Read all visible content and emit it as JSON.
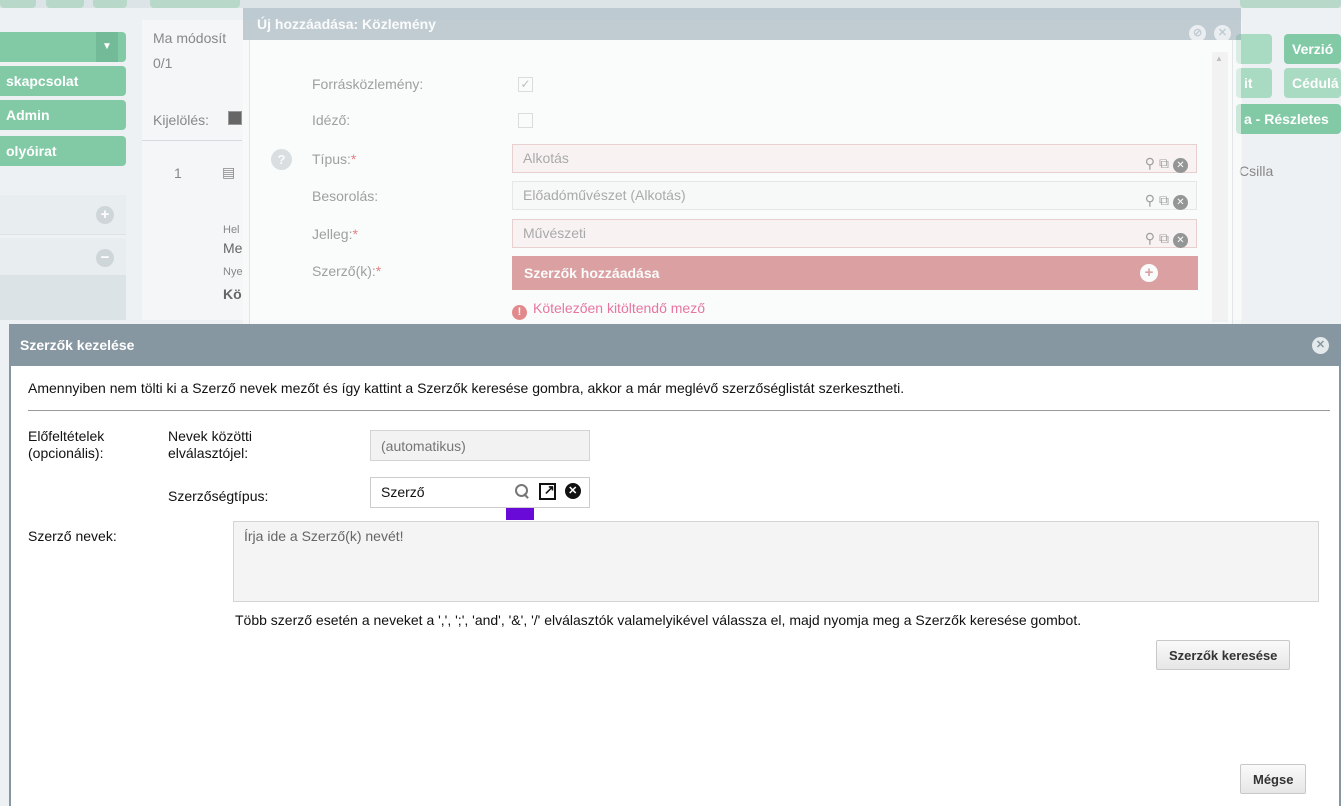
{
  "background": {
    "left_buttons": [
      "",
      "skapcsolat",
      "Admin",
      "olyóirat"
    ],
    "mid": {
      "modified_label": "Ma módosít",
      "count": "0/1",
      "selection_label": "Kijelölés:",
      "row_number": "1",
      "row_texts": [
        "Hel",
        "Me",
        "Nye",
        "Kö"
      ]
    },
    "right_buttons": [
      "Verzió",
      "it",
      "Cédulá",
      "a - Részletes"
    ],
    "right_name": "Csilla"
  },
  "dialog1": {
    "title": "Új hozzáadása: Közlemény",
    "source_label": "Forrásközlemény:",
    "quoting_label": "Idéző:",
    "type_label": "Típus:",
    "type_value": "Alkotás",
    "class_label": "Besorolás:",
    "class_value": "Előadóművészet (Alkotás)",
    "nature_label": "Jelleg:",
    "nature_value": "Művészeti",
    "authors_label": "Szerző(k):",
    "required_mark": "*",
    "add_authors_label": "Szerzők hozzáadása",
    "error_text": "Kötelezően kitöltendő mező"
  },
  "dialog2": {
    "title": "Szerzők kezelése",
    "info": "Amennyiben nem tölti ki a Szerző nevek mezőt és így kattint a Szerzők keresése gombra, akkor a már meglévő szerzőséglistát szerkesztheti.",
    "prereq_label": "Előfeltételek (opcionális):",
    "separator_label": "Nevek közötti elválasztójel:",
    "separator_placeholder": "(automatikus)",
    "authortype_label": "Szerzőségtípus:",
    "authortype_value": "Szerző",
    "names_label": "Szerző nevek:",
    "names_placeholder": "Írja ide a Szerző(k) nevét!",
    "hint": "Több szerző esetén a neveket a ',', ';', 'and', '&', '/' elválasztók valamelyikével válassza el, majd nyomja meg a Szerzők keresése gombot.",
    "search_button": "Szerzők keresése",
    "cancel_button": "Mégse"
  },
  "colors": {
    "header": "#8797a2",
    "green": "#82c9a6",
    "required_bar": "#cc6a6a",
    "marker": "#6a0ad8"
  }
}
